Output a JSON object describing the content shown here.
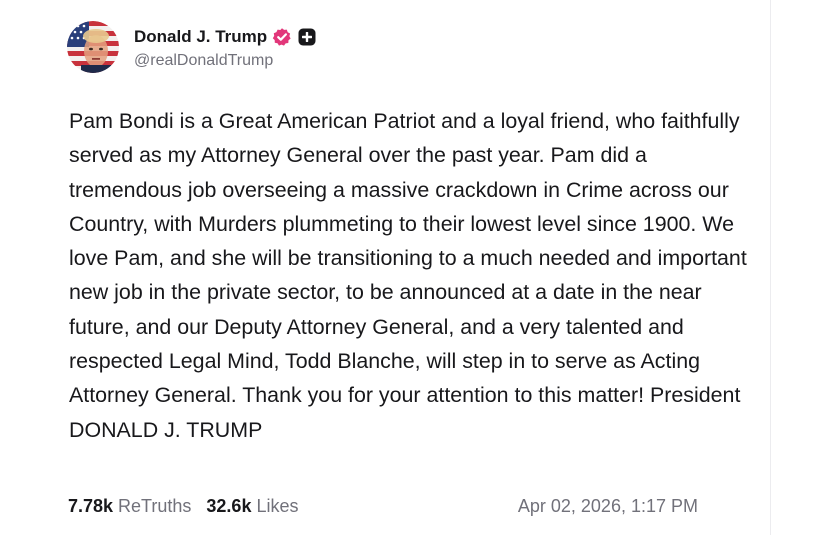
{
  "author": {
    "display_name": "Donald J. Trump",
    "handle": "@realDonaldTrump",
    "avatar_icon": "avatar-flag-portrait",
    "verified_icon": "verified-badge-icon",
    "verified_color": "#e2377a",
    "plus_icon": "plus-square-icon"
  },
  "post": {
    "text": "Pam Bondi is a Great American Patriot and a loyal friend, who faithfully served as my Attorney General over the past year. Pam did a tremendous job overseeing a massive crackdown in Crime across our Country, with Murders plummeting to their lowest level since 1900. We love Pam, and she will be transitioning to a much needed and important new job in the private sector, to be announced at a date in the near future, and our Deputy Attorney General, and a very talented and respected Legal Mind, Todd Blanche, will step in to serve as Acting Attorney General. Thank you for your attention to this matter! President DONALD J. TRUMP"
  },
  "stats": {
    "retruths_count": "7.78k",
    "retruths_label": "ReTruths",
    "likes_count": "32.6k",
    "likes_label": "Likes"
  },
  "timestamp": "Apr 02, 2026, 1:17 PM",
  "colors": {
    "text_primary": "#18181b",
    "text_secondary": "#71717a"
  }
}
